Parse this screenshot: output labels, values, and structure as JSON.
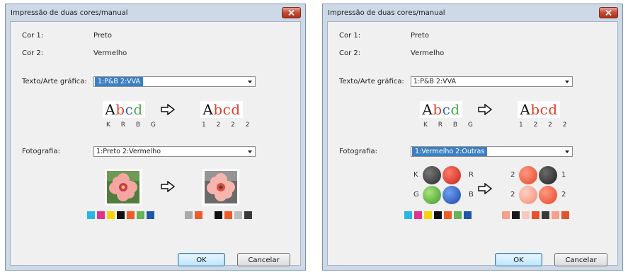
{
  "dialog1": {
    "title": "Impressão de duas cores/manual",
    "cor1_label": "Cor 1:",
    "cor1_value": "Preto",
    "cor2_label": "Cor 2:",
    "cor2_value": "Vermelho",
    "texto_label": "Texto/Arte gráfica:",
    "texto_value": "1:P&B 2:VVA",
    "sample_text": "Abcd",
    "codes_before": "K R B G",
    "codes_after": "1 2 2 2",
    "foto_label": "Fotografia:",
    "foto_value": "1:Preto 2:Vermelho",
    "ok": "OK",
    "cancel": "Cancelar"
  },
  "dialog2": {
    "title": "Impressão de duas cores/manual",
    "cor1_label": "Cor 1:",
    "cor1_value": "Preto",
    "cor2_label": "Cor 2:",
    "cor2_value": "Vermelho",
    "texto_label": "Texto/Arte gráfica:",
    "texto_value": "1:P&B 2:VVA",
    "sample_text": "Abcd",
    "codes_before": "K R B G",
    "codes_after": "1 2 2 2",
    "foto_label": "Fotografia:",
    "foto_value": "1:Vermelho 2:Outras",
    "balls_before": {
      "tl": "K",
      "tr": "R",
      "bl": "G",
      "br": "B"
    },
    "balls_after": {
      "tl": "2",
      "tr": "1",
      "bl": "2",
      "br": "2"
    },
    "ok": "OK",
    "cancel": "Cancelar"
  },
  "colors": {
    "palette_original": [
      "#27b6e6",
      "#e0328f",
      "#f6d40d",
      "#111111",
      "#ef5a27",
      "#63b557",
      "#2057a8"
    ],
    "palette_converted_1": [
      "#a9a9a9",
      "#f05a2a",
      "#f0f0f0",
      "#111111",
      "#f05a2a",
      "#bdbdbd",
      "#3a3a3a"
    ],
    "palette_converted_2": [
      "#f4a08a",
      "#1a1a1a",
      "#f7c8bf",
      "#e8502a",
      "#3a3a3a",
      "#f4a08a",
      "#e8502a"
    ]
  }
}
